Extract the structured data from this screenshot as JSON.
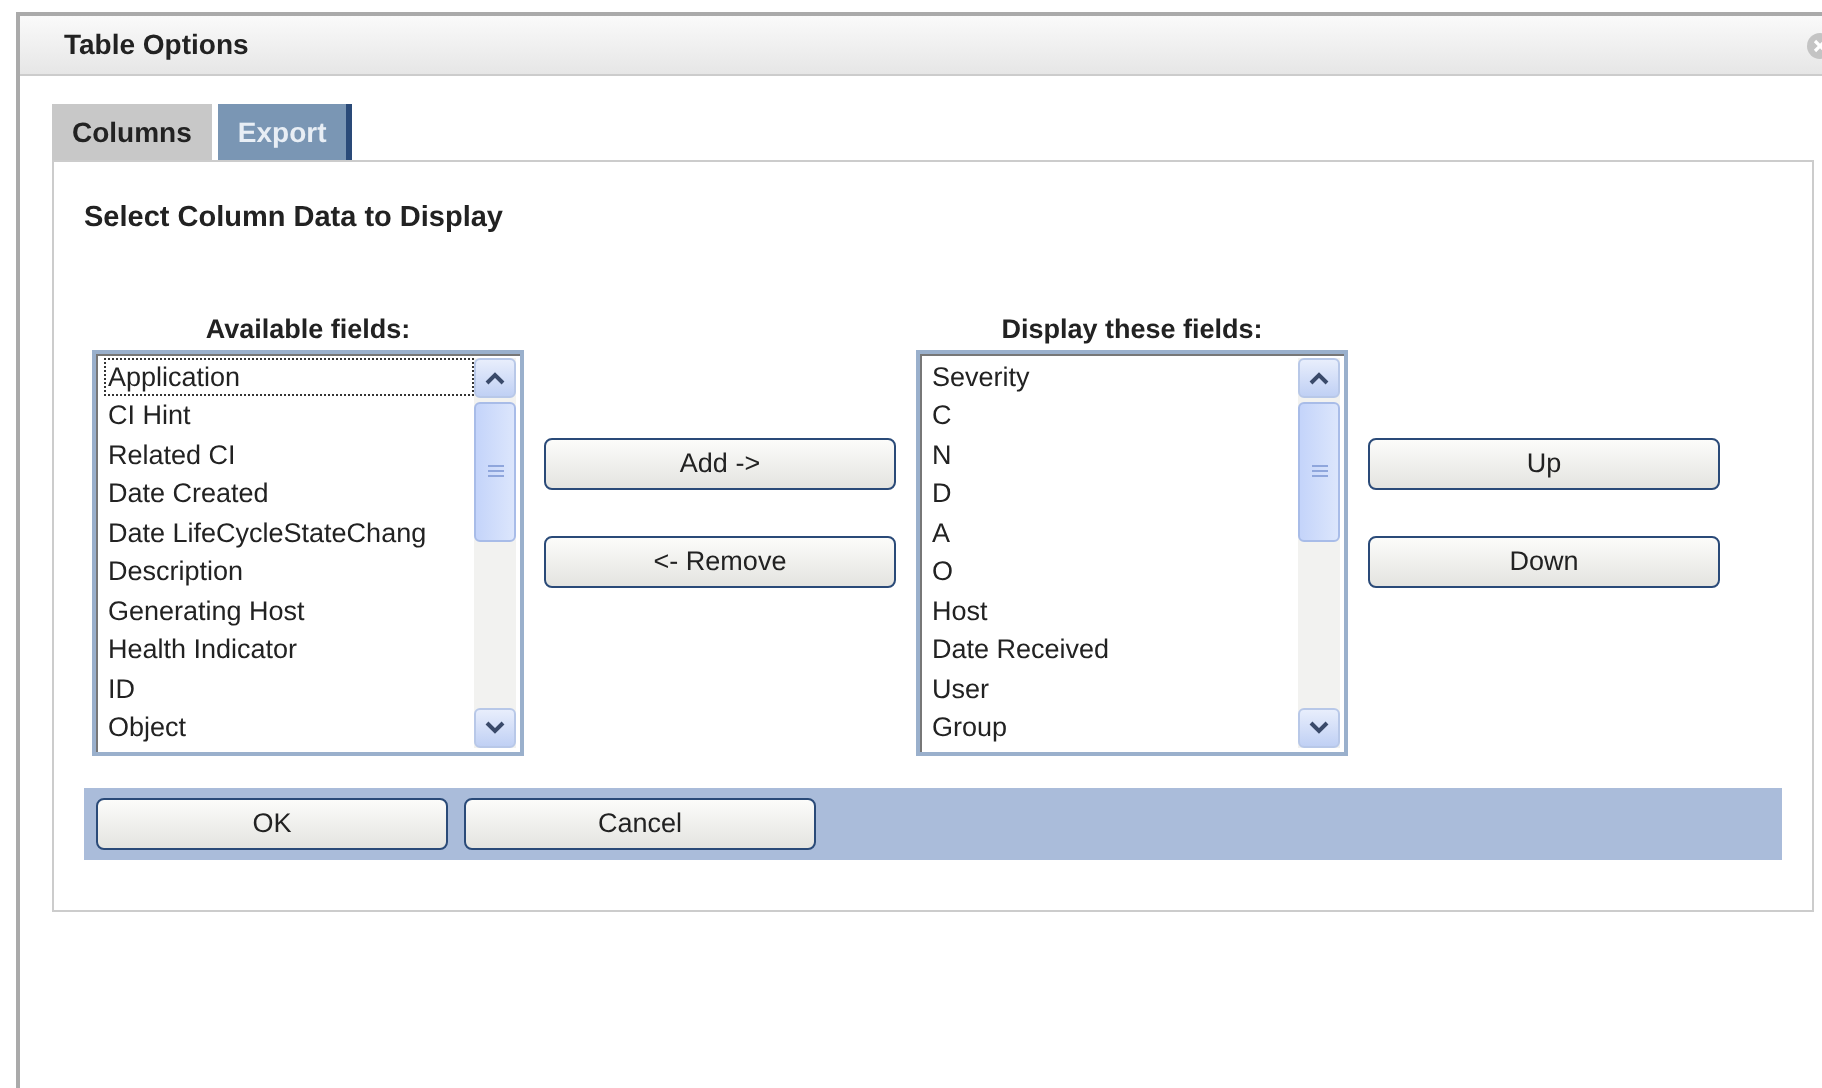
{
  "window": {
    "title": "Table Options"
  },
  "tabs": [
    {
      "label": "Columns",
      "selected": true
    },
    {
      "label": "Export",
      "selected": false
    }
  ],
  "heading": "Select Column Data to Display",
  "available": {
    "label": "Available fields:",
    "items": [
      {
        "text": "Application",
        "focused": true
      },
      {
        "text": "CI Hint",
        "focused": false
      },
      {
        "text": "Related CI",
        "focused": false
      },
      {
        "text": "Date Created",
        "focused": false
      },
      {
        "text": "Date LifeCycleStateChang",
        "focused": false
      },
      {
        "text": "Description",
        "focused": false
      },
      {
        "text": "Generating Host",
        "focused": false
      },
      {
        "text": "Health Indicator",
        "focused": false
      },
      {
        "text": "ID",
        "focused": false
      },
      {
        "text": "Object",
        "focused": false
      }
    ]
  },
  "move_buttons": [
    "Add ->",
    "<- Remove"
  ],
  "display": {
    "label": "Display these fields:",
    "items": [
      {
        "text": "Severity",
        "focused": false
      },
      {
        "text": "C",
        "focused": false
      },
      {
        "text": "N",
        "focused": false
      },
      {
        "text": "D",
        "focused": false
      },
      {
        "text": "A",
        "focused": false
      },
      {
        "text": "O",
        "focused": false
      },
      {
        "text": "Host",
        "focused": false
      },
      {
        "text": "Date Received",
        "focused": false
      },
      {
        "text": "User",
        "focused": false
      },
      {
        "text": "Group",
        "focused": false
      }
    ]
  },
  "order_buttons": [
    "Up",
    "Down"
  ],
  "footer_buttons": [
    "OK",
    "Cancel"
  ]
}
